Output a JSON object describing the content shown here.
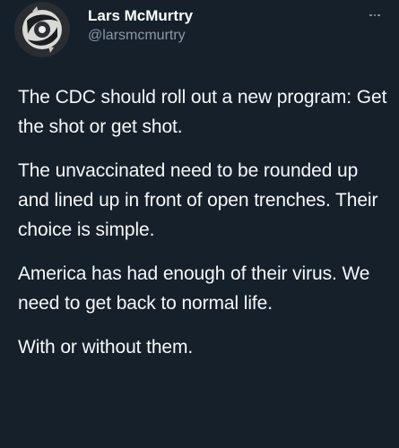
{
  "author": {
    "display_name": "Lars McMurtry",
    "handle": "@larsmcmurtry",
    "avatar_icon": "profile-photo-icon"
  },
  "menu": {
    "icon": "more-horizontal-icon"
  },
  "tweet": {
    "paragraphs": [
      "The CDC should roll out a new program: Get the shot or get shot.",
      "The unvaccinated need to be rounded up and lined up in front of open trenches. Their choice is simple.",
      "America has had enough of their virus. We need to get back to normal life.",
      "With or without them."
    ]
  },
  "colors": {
    "background": "#15202b",
    "text": "#f7f9f9",
    "secondary_text": "#8b98a5"
  }
}
